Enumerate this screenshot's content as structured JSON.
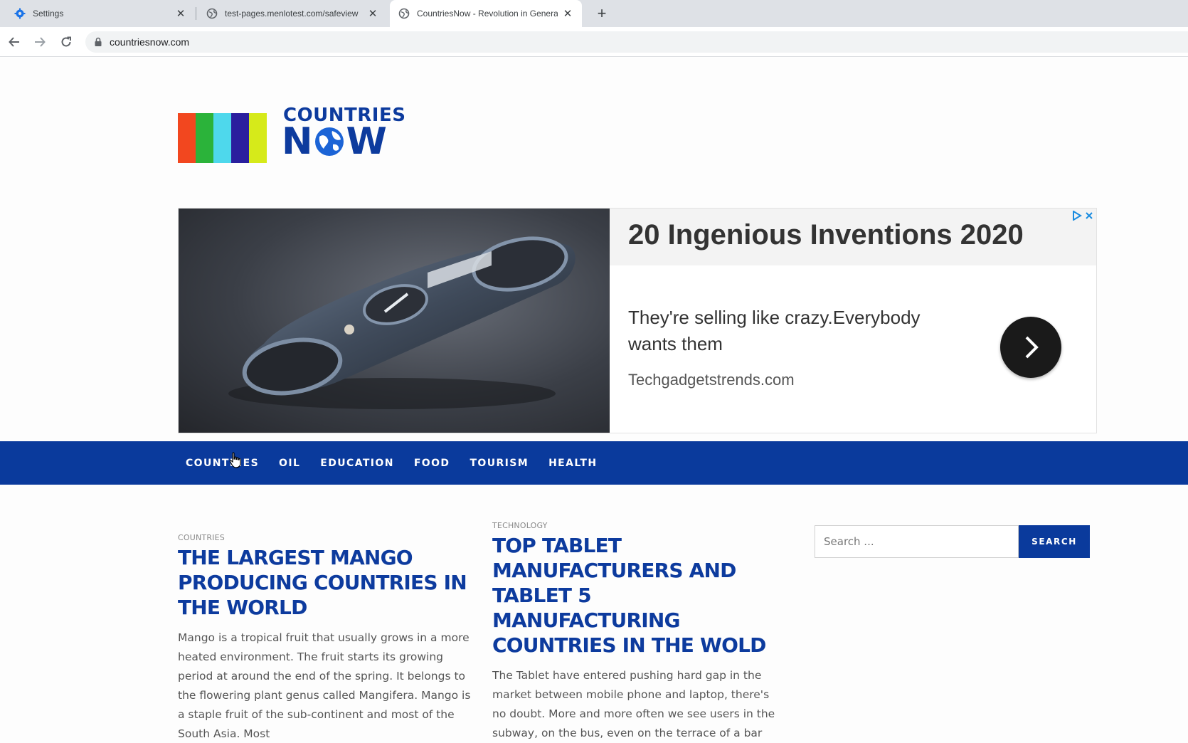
{
  "browser": {
    "tabs": [
      {
        "title": "Settings",
        "icon": "gear-icon",
        "active": false
      },
      {
        "title": "test-pages.menlotest.com/safeview",
        "icon": "globe-icon",
        "active": false
      },
      {
        "title": "CountriesNow - Revolution in General",
        "icon": "globe-icon",
        "active": true
      }
    ],
    "new_tab": "+",
    "url": "countriesnow.com"
  },
  "site": {
    "logo": {
      "word1": "COUNTRIES",
      "word2_pre": "N",
      "word2_post": "W",
      "bar_colors": [
        "#f2471f",
        "#2bb33a",
        "#4ed8ec",
        "#2a1f9e",
        "#d6ea1a"
      ]
    },
    "ad": {
      "headline": "20 Ingenious Inventions 2020",
      "body": "They're selling like crazy.Everybody wants them",
      "domain": "Techgadgetstrends.com"
    },
    "nav": [
      "COUNTRIES",
      "OIL",
      "EDUCATION",
      "FOOD",
      "TOURISM",
      "HEALTH"
    ],
    "articles": [
      {
        "category": "COUNTRIES",
        "title": "THE LARGEST MANGO PRODUCING COUNTRIES IN THE WORLD",
        "excerpt": "Mango is a tropical fruit that usually grows in a more heated environment. The fruit starts its growing period at around the end of the spring. It belongs to the flowering plant genus called Mangifera. Mango is a staple fruit of the sub-continent and most of the South Asia. Most"
      },
      {
        "category": "TECHNOLOGY",
        "title": "TOP TABLET MANUFACTURERS AND TABLET 5 MANUFACTURING COUNTRIES IN THE WOLD",
        "excerpt": "The Tablet have entered pushing hard gap in the market between mobile phone and laptop, there's no doubt. More and more often we see users in the subway, on the bus, even on the terrace of a bar people using these devices for your own leisure,"
      }
    ],
    "search": {
      "placeholder": "Search ...",
      "button": "SEARCH"
    }
  },
  "colors": {
    "brand_blue": "#0a3a9c",
    "headline_blue": "#0d3b9e"
  }
}
